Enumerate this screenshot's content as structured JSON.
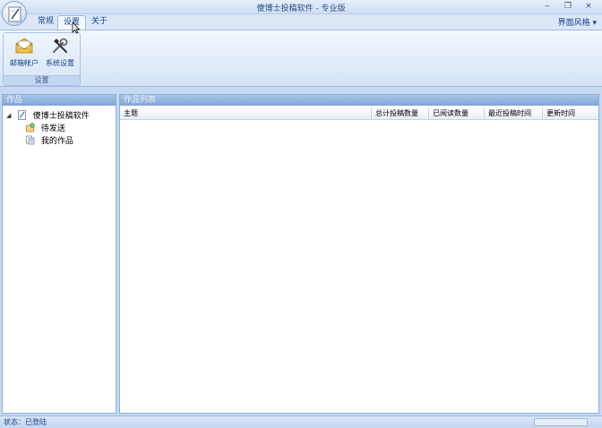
{
  "window": {
    "title": "傻博士投稿软件 - 专业版",
    "minimize_glyph": "‒",
    "maximize_glyph": "❐",
    "close_glyph": "×"
  },
  "ribbon": {
    "tabs": [
      {
        "label": "常规"
      },
      {
        "label": "设置",
        "active": true
      },
      {
        "label": "关于"
      }
    ],
    "theme_menu_label": "界面风格",
    "theme_menu_arrow": "▾",
    "groups": [
      {
        "label": "设置",
        "buttons": [
          {
            "label": "邮箱帐户",
            "icon": "mail-icon"
          },
          {
            "label": "系统设置",
            "icon": "tools-icon"
          }
        ]
      }
    ]
  },
  "left_panel": {
    "header": "作品",
    "tree": {
      "root": {
        "label": "傻博士投稿软件",
        "expand_glyph": "◢",
        "icon": "document-icon"
      },
      "children": [
        {
          "label": "待发送",
          "icon": "outbox-icon"
        },
        {
          "label": "我的作品",
          "icon": "works-icon"
        }
      ]
    }
  },
  "right_panel": {
    "header": "作品列表",
    "columns": [
      "主题",
      "总计投稿数量",
      "已阅读数量",
      "最近投稿时间",
      "更新时间"
    ],
    "rows": []
  },
  "status_bar": {
    "text": "状态：已登陆"
  },
  "colors": {
    "accent": "#15428b",
    "frame": "#c6d9f1",
    "panel_header": "#7fa5d6"
  }
}
